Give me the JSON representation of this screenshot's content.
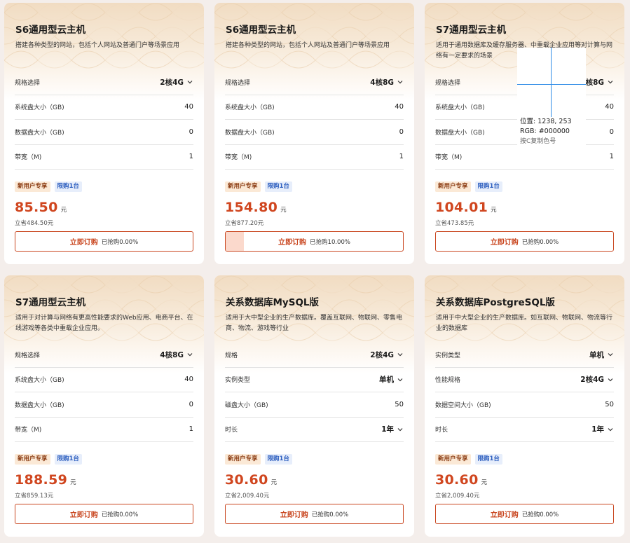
{
  "cards": [
    {
      "title": "S6通用型云主机",
      "desc": "搭建各种类型的网站，包括个人网站及普通门户等场景应用",
      "rows": [
        {
          "label": "规格选择",
          "value": "2核4G",
          "dropdown": true
        },
        {
          "label": "系统盘大小（GB)",
          "value": "40",
          "dropdown": false
        },
        {
          "label": "数据盘大小（GB)",
          "value": "0",
          "dropdown": false
        },
        {
          "label": "带宽（M)",
          "value": "1",
          "dropdown": false
        }
      ],
      "tag_new": "新用户专享",
      "tag_limit": "限购1台",
      "price": "85.50",
      "price_unit": "元",
      "saved": "立省484.50元",
      "buy_label": "立即订购",
      "sold": "已抢购0.00%",
      "sold_fraction": 0
    },
    {
      "title": "S6通用型云主机",
      "desc": "搭建各种类型的网站，包括个人网站及普通门户等场景应用",
      "rows": [
        {
          "label": "规格选择",
          "value": "4核8G",
          "dropdown": true
        },
        {
          "label": "系统盘大小（GB)",
          "value": "40",
          "dropdown": false
        },
        {
          "label": "数据盘大小（GB)",
          "value": "0",
          "dropdown": false
        },
        {
          "label": "带宽（M)",
          "value": "1",
          "dropdown": false
        }
      ],
      "tag_new": "新用户专享",
      "tag_limit": "限购1台",
      "price": "154.80",
      "price_unit": "元",
      "saved": "立省877.20元",
      "buy_label": "立即订购",
      "sold": "已抢购10.00%",
      "sold_fraction": 0.1
    },
    {
      "title": "S7通用型云主机",
      "desc": "适用于通用数据库及缓存服务器、中重载企业应用等对计算与网络有一定要求的场景",
      "rows": [
        {
          "label": "规格选择",
          "value": "4核8G",
          "dropdown": true
        },
        {
          "label": "系统盘大小（GB)",
          "value": "40",
          "dropdown": false
        },
        {
          "label": "数据盘大小（GB)",
          "value": "0",
          "dropdown": false
        },
        {
          "label": "带宽（M)",
          "value": "1",
          "dropdown": false
        }
      ],
      "tag_new": "新用户专享",
      "tag_limit": "限购1台",
      "price": "104.01",
      "price_unit": "元",
      "saved": "立省473.85元",
      "buy_label": "立即订购",
      "sold": "已抢购0.00%",
      "sold_fraction": 0
    },
    {
      "title": "S7通用型云主机",
      "desc": "适用于对计算与网络有更高性能要求的Web应用、电商平台、在线游戏等各类中重载企业应用。",
      "rows": [
        {
          "label": "规格选择",
          "value": "4核8G",
          "dropdown": true
        },
        {
          "label": "系统盘大小（GB)",
          "value": "40",
          "dropdown": false
        },
        {
          "label": "数据盘大小（GB)",
          "value": "0",
          "dropdown": false
        },
        {
          "label": "带宽（M)",
          "value": "1",
          "dropdown": false
        }
      ],
      "tag_new": "新用户专享",
      "tag_limit": "限购1台",
      "price": "188.59",
      "price_unit": "元",
      "saved": "立省859.13元",
      "buy_label": "立即订购",
      "sold": "已抢购0.00%",
      "sold_fraction": 0
    },
    {
      "title": "关系数据库MySQL版",
      "desc": "适用于大中型企业的生产数据库。覆盖互联网、物联网、零售电商、物流、游戏等行业",
      "rows": [
        {
          "label": "规格",
          "value": "2核4G",
          "dropdown": true
        },
        {
          "label": "实例类型",
          "value": "单机",
          "dropdown": true
        },
        {
          "label": "磁盘大小（GB)",
          "value": "50",
          "dropdown": false
        },
        {
          "label": "时长",
          "value": "1年",
          "dropdown": true
        }
      ],
      "tag_new": "新用户专享",
      "tag_limit": "限购1台",
      "price": "30.60",
      "price_unit": "元",
      "saved": "立省2,009.40元",
      "buy_label": "立即订购",
      "sold": "已抢购0.00%",
      "sold_fraction": 0
    },
    {
      "title": "关系数据库PostgreSQL版",
      "desc": "适用于中大型企业的生产数据库。如互联网、物联网、物流等行业的数据库",
      "rows": [
        {
          "label": "实例类型",
          "value": "单机",
          "dropdown": true
        },
        {
          "label": "性能规格",
          "value": "2核4G",
          "dropdown": true
        },
        {
          "label": "数据空间大小（GB)",
          "value": "50",
          "dropdown": false
        },
        {
          "label": "时长",
          "value": "1年",
          "dropdown": true
        }
      ],
      "tag_new": "新用户专享",
      "tag_limit": "限购1台",
      "price": "30.60",
      "price_unit": "元",
      "saved": "立省2,009.40元",
      "buy_label": "立即订购",
      "sold": "已抢购0.00%",
      "sold_fraction": 0
    }
  ],
  "picker": {
    "position_text": "位置: 1238, 253",
    "rgb_text": "RGB: #000000",
    "hint_text": "按C复制色号"
  },
  "icons": {
    "dropdown": "chevron-down-icon"
  },
  "colors": {
    "accent": "#c9461f",
    "price": "#d0461f",
    "tag_new_bg": "#fbe9d6",
    "tag_limit_bg": "#e7eefb"
  }
}
